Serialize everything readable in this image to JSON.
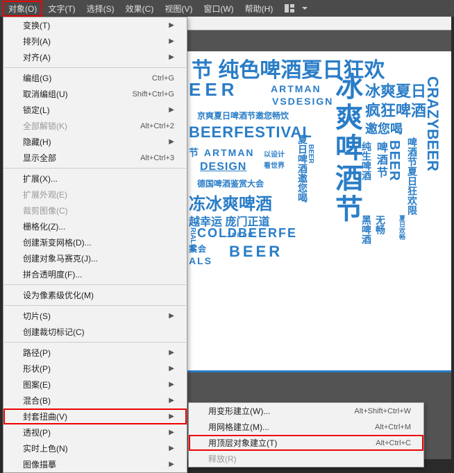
{
  "menubar": {
    "items": [
      {
        "label": "对象(O)",
        "active": true
      },
      {
        "label": "文字(T)"
      },
      {
        "label": "选择(S)"
      },
      {
        "label": "效果(C)"
      },
      {
        "label": "视图(V)"
      },
      {
        "label": "窗口(W)"
      },
      {
        "label": "帮助(H)"
      }
    ]
  },
  "dropdown": [
    {
      "label": "变换(T)",
      "arrow": true
    },
    {
      "label": "排列(A)",
      "arrow": true
    },
    {
      "label": "对齐(A)",
      "arrow": true
    },
    {
      "sep": true
    },
    {
      "label": "编组(G)",
      "shortcut": "Ctrl+G"
    },
    {
      "label": "取消编组(U)",
      "shortcut": "Shift+Ctrl+G"
    },
    {
      "label": "锁定(L)",
      "arrow": true
    },
    {
      "label": "全部解锁(K)",
      "shortcut": "Alt+Ctrl+2",
      "disabled": true
    },
    {
      "label": "隐藏(H)",
      "arrow": true
    },
    {
      "label": "显示全部",
      "shortcut": "Alt+Ctrl+3"
    },
    {
      "sep": true
    },
    {
      "label": "扩展(X)..."
    },
    {
      "label": "扩展外观(E)",
      "disabled": true
    },
    {
      "label": "裁剪图像(C)",
      "disabled": true
    },
    {
      "label": "栅格化(Z)..."
    },
    {
      "label": "创建渐变网格(D)..."
    },
    {
      "label": "创建对象马赛克(J)..."
    },
    {
      "label": "拼合透明度(F)..."
    },
    {
      "sep": true
    },
    {
      "label": "设为像素级优化(M)"
    },
    {
      "sep": true
    },
    {
      "label": "切片(S)",
      "arrow": true
    },
    {
      "label": "创建裁切标记(C)"
    },
    {
      "sep": true
    },
    {
      "label": "路径(P)",
      "arrow": true
    },
    {
      "label": "形状(P)",
      "arrow": true
    },
    {
      "label": "图案(E)",
      "arrow": true
    },
    {
      "label": "混合(B)",
      "arrow": true
    },
    {
      "label": "封套扭曲(V)",
      "arrow": true,
      "highlight": true
    },
    {
      "label": "透视(P)",
      "arrow": true
    },
    {
      "label": "实时上色(N)",
      "arrow": true
    },
    {
      "label": "图像描摹",
      "arrow": true
    }
  ],
  "submenu": [
    {
      "label": "用变形建立(W)...",
      "shortcut": "Alt+Shift+Ctrl+W"
    },
    {
      "label": "用网格建立(M)...",
      "shortcut": "Alt+Ctrl+M"
    },
    {
      "label": "用顶层对象建立(T)",
      "shortcut": "Alt+Ctrl+C",
      "highlight": true
    },
    {
      "label": "释放(R)",
      "disabled": true
    }
  ],
  "artwork": {
    "t1": "节 纯色啤酒夏日狂欢",
    "t2": "EER",
    "t3": "ARTMAN",
    "t4": "VSDESIGN",
    "t4b": "冰爽夏日",
    "t4c": "疯狂啤酒",
    "t5": "京爽夏日啤酒节邀您畅饮",
    "t5b": "邀您喝",
    "t6": "BEERFESTIVAL",
    "t7": "节 ARTMAN",
    "t8": "DESIGN",
    "t8b": "以设计",
    "t8c": "看世界",
    "t9": "德国啤酒鉴赏大会",
    "t10": "冻冰爽啤酒",
    "t11": "越幸运 庞门正道",
    "t12": "COLDBEERFE",
    "t12a": "RIALSE",
    "t13": "案会",
    "t14": "BEER",
    "t15": "ALS",
    "t16": "JAPAN",
    "v1": "冰爽啤酒节",
    "v2": "夏日啤酒邀您喝",
    "v3": "CRAZYBEER",
    "v4": "纯生啤酒",
    "v5": "啤酒节",
    "v6": "BEER",
    "v7": "啤酒节夏日狂欢限",
    "v8": "黑啤酒",
    "v9": "无畅",
    "v10": " 饮",
    "v11": "",
    "v12": "",
    "v13": "夏日欢畅",
    "v14": "BEER"
  }
}
